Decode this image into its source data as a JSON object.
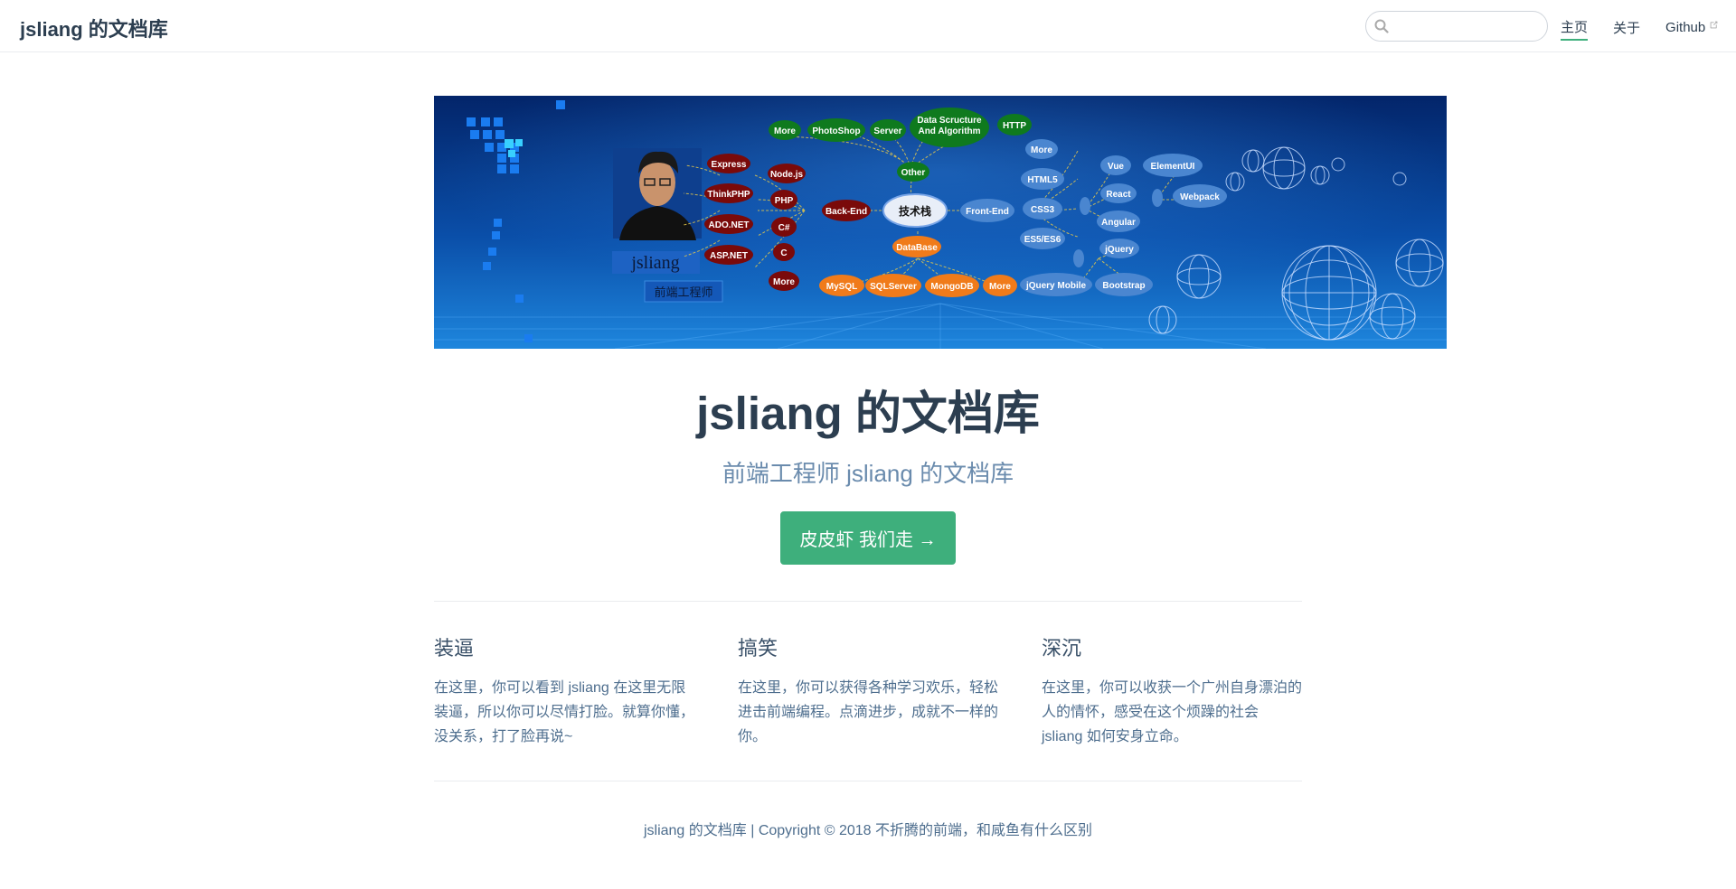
{
  "navbar": {
    "site_name": "jsliang 的文档库",
    "search_placeholder": "",
    "links": [
      {
        "label": "主页",
        "active": true
      },
      {
        "label": "关于",
        "active": false
      },
      {
        "label": "Github",
        "external": true
      }
    ]
  },
  "banner": {
    "name_label": "jsliang",
    "role_label": "前端工程师",
    "center_node": "技术栈",
    "backend": {
      "label": "Back-End",
      "children": [
        "Node.js",
        "PHP",
        "C#",
        "C",
        "More"
      ],
      "leaves": [
        "Express",
        "ThinkPHP",
        "ADO.NET",
        "ASP.NET"
      ]
    },
    "other": {
      "label": "Other",
      "children": [
        "More",
        "PhotoShop",
        "Server",
        "Data Scructure And Algorithm",
        "HTTP"
      ]
    },
    "frontend": {
      "label": "Front-End",
      "children": [
        "More",
        "HTML5",
        "CSS3",
        "ES5/ES6"
      ],
      "frameworks": [
        "Vue",
        "React",
        "Angular",
        "ElementUI",
        "Webpack",
        "jQuery",
        "jQuery Mobile",
        "Bootstrap"
      ]
    },
    "database": {
      "label": "DataBase",
      "children": [
        "MySQL",
        "SQLServer",
        "MongoDB",
        "More"
      ]
    },
    "colors": {
      "bg_dark": "#04296f",
      "bg_light": "#1f7fd8",
      "backend": "#7a0a0a",
      "other": "#0f7a1e",
      "frontend": "#4a86d0",
      "database": "#f07b1a"
    }
  },
  "hero": {
    "title": "jsliang 的文档库",
    "description": "前端工程师 jsliang 的文档库",
    "action_label": "皮皮虾 我们走 →"
  },
  "features": [
    {
      "title": "装逼",
      "details": "在这里，你可以看到 jsliang 在这里无限装逼，所以你可以尽情打脸。就算你懂，没关系，打了脸再说~"
    },
    {
      "title": "搞笑",
      "details": "在这里，你可以获得各种学习欢乐，轻松进击前端编程。点滴进步，成就不一样的你。"
    },
    {
      "title": "深沉",
      "details": "在这里，你可以收获一个广州自身漂泊的人的情怀，感受在这个烦躁的社会 jsliang 如何安身立命。"
    }
  ],
  "footer": {
    "text": "jsliang 的文档库 | Copyright © 2018 不折腾的前端，和咸鱼有什么区别"
  },
  "colors": {
    "accent": "#3eaf7c",
    "text": "#2c3e50",
    "muted": "#6a8bad"
  }
}
